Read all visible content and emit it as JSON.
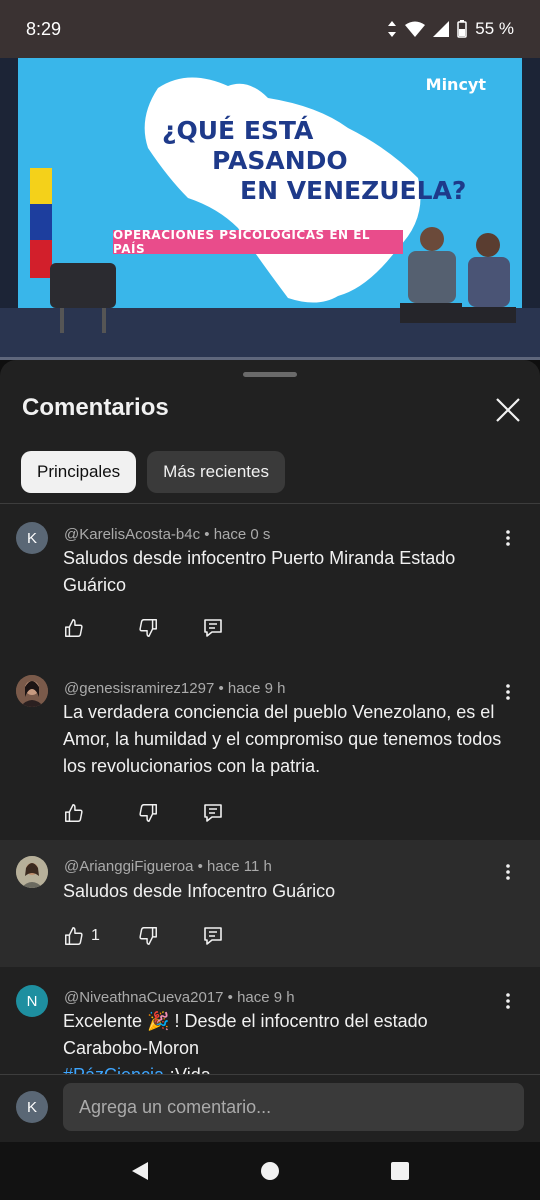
{
  "status_bar": {
    "time": "8:29",
    "battery": "55 %"
  },
  "video": {
    "headline_line1": "¿QUÉ ESTÁ",
    "headline_line2": "PASANDO",
    "headline_line3": "EN VENEZUELA?",
    "banner": "OPERACIONES PSICOLÓGICAS EN EL PAÍS",
    "logo": "Mincyt"
  },
  "sheet": {
    "title": "Comentarios",
    "tabs": [
      {
        "label": "Principales",
        "active": true
      },
      {
        "label": "Más recientes",
        "active": false
      }
    ]
  },
  "comments": [
    {
      "avatar_letter": "K",
      "avatar_color": "#5a6775",
      "meta": "@KarelisAcosta-b4c • hace 0 s",
      "text": "Saludos desde infocentro Puerto Miranda Estado Guárico",
      "likes": ""
    },
    {
      "avatar_letter": "",
      "avatar_color": "#7a5a4a",
      "meta": "@genesisramirez1297 • hace 9 h",
      "text": "La verdadera conciencia del pueblo Venezolano, es el Amor, la humildad y el compromiso que tenemos todos los revolucionarios con la patria.",
      "likes": ""
    },
    {
      "avatar_letter": "",
      "avatar_color": "#8a8a78",
      "meta": "@ArianggiFigueroa • hace 11 h",
      "text": "Saludos desde Infocentro Guárico",
      "likes": "1"
    },
    {
      "avatar_letter": "N",
      "avatar_color": "#1e8fa0",
      "meta": "@NiveathnaCueva2017 • hace 9 h",
      "text": "Excelente 🎉 ! Desde el infocentro del estado Carabobo-Moron",
      "text_tag": "#PázCiencia",
      "text_tail": " ¡Vida",
      "likes": ""
    }
  ],
  "add_comment": {
    "avatar_letter": "K",
    "placeholder": "Agrega un comentario..."
  },
  "colors": {
    "accent_link": "#3ea6ff",
    "sheet_bg": "#212121"
  }
}
